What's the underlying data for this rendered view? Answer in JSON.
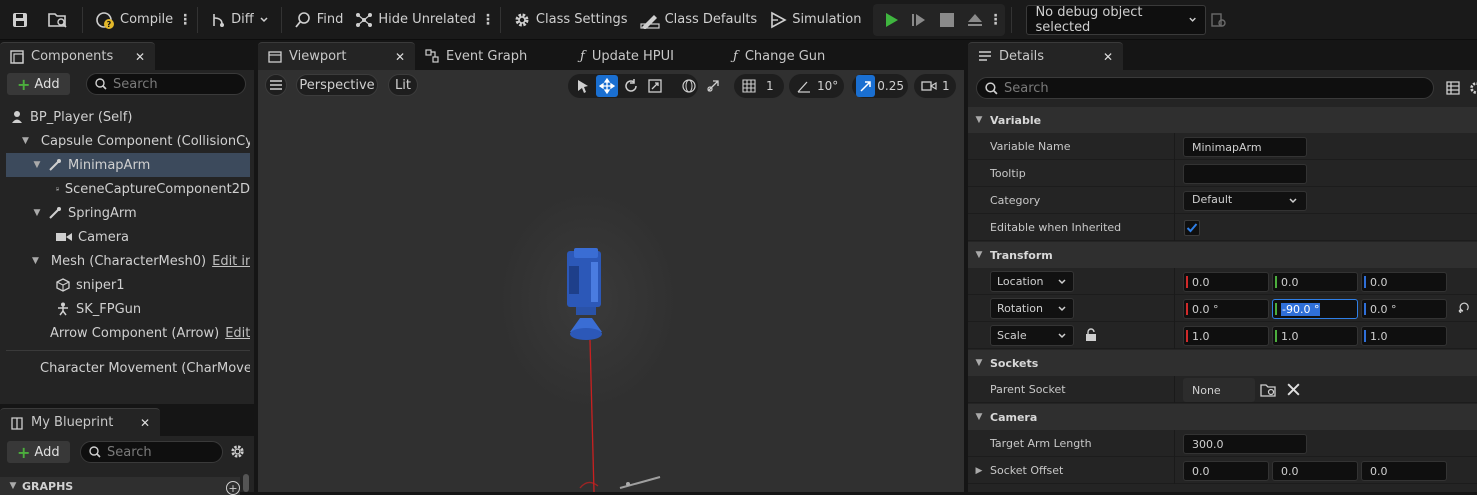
{
  "toolbar": {
    "compile_label": "Compile",
    "diff_label": "Diff",
    "find_label": "Find",
    "hide_unrelated_label": "Hide Unrelated",
    "class_settings_label": "Class Settings",
    "class_defaults_label": "Class Defaults",
    "simulation_label": "Simulation",
    "debug_select_value": "No debug object selected"
  },
  "components_panel": {
    "tab_label": "Components",
    "add_label": "Add",
    "search_placeholder": "Search",
    "items": [
      {
        "label": "BP_Player (Self)"
      },
      {
        "label": "Capsule Component (CollisionCylinder)"
      },
      {
        "label": "MinimapArm"
      },
      {
        "label": "SceneCaptureComponent2D"
      },
      {
        "label": "SpringArm"
      },
      {
        "label": "Camera"
      },
      {
        "label": "Mesh (CharacterMesh0)",
        "edit": "Edit in"
      },
      {
        "label": "sniper1"
      },
      {
        "label": "SK_FPGun"
      },
      {
        "label": "Arrow Component (Arrow)",
        "edit": "Edit"
      },
      {
        "label": "Character Movement (CharMoveComp)"
      }
    ]
  },
  "my_blueprint_panel": {
    "tab_label": "My Blueprint",
    "add_label": "Add",
    "search_placeholder": "Search",
    "graphs_label": "GRAPHS"
  },
  "editor_tabs": [
    {
      "label": "Viewport"
    },
    {
      "label": "Event Graph"
    },
    {
      "label": "Update HPUI"
    },
    {
      "label": "Change Gun"
    }
  ],
  "viewport": {
    "perspective_label": "Perspective",
    "lit_label": "Lit",
    "grid_value": "1",
    "rotation_snap_value": "10°",
    "scale_snap_value": "0.25",
    "camera_speed_value": "1"
  },
  "details": {
    "tab_label": "Details",
    "search_placeholder": "Search",
    "variable": {
      "header": "Variable",
      "name_label": "Variable Name",
      "name_value": "MinimapArm",
      "tooltip_label": "Tooltip",
      "tooltip_value": "",
      "category_label": "Category",
      "category_value": "Default",
      "editable_label": "Editable when Inherited",
      "editable_checked": true
    },
    "transform": {
      "header": "Transform",
      "location_label": "Location",
      "location": [
        "0.0",
        "0.0",
        "0.0"
      ],
      "rotation_label": "Rotation",
      "rotation": [
        "0.0 °",
        "-90.0 °",
        "0.0 °"
      ],
      "scale_label": "Scale",
      "scale": [
        "1.0",
        "1.0",
        "1.0"
      ]
    },
    "sockets": {
      "header": "Sockets",
      "parent_socket_label": "Parent Socket",
      "parent_socket_value": "None"
    },
    "camera": {
      "header": "Camera",
      "target_arm_length_label": "Target Arm Length",
      "target_arm_length_value": "300.0",
      "socket_offset_label": "Socket Offset",
      "socket_offset": [
        "0.0",
        "0.0",
        "0.0"
      ]
    }
  },
  "colors": {
    "accent": "#1a6fd1",
    "selected_row": "#3c4a5c",
    "play_green": "#3fb53f",
    "axis_x": "#d02a2a",
    "axis_y": "#4cae3d",
    "axis_z": "#2f6fd8"
  }
}
